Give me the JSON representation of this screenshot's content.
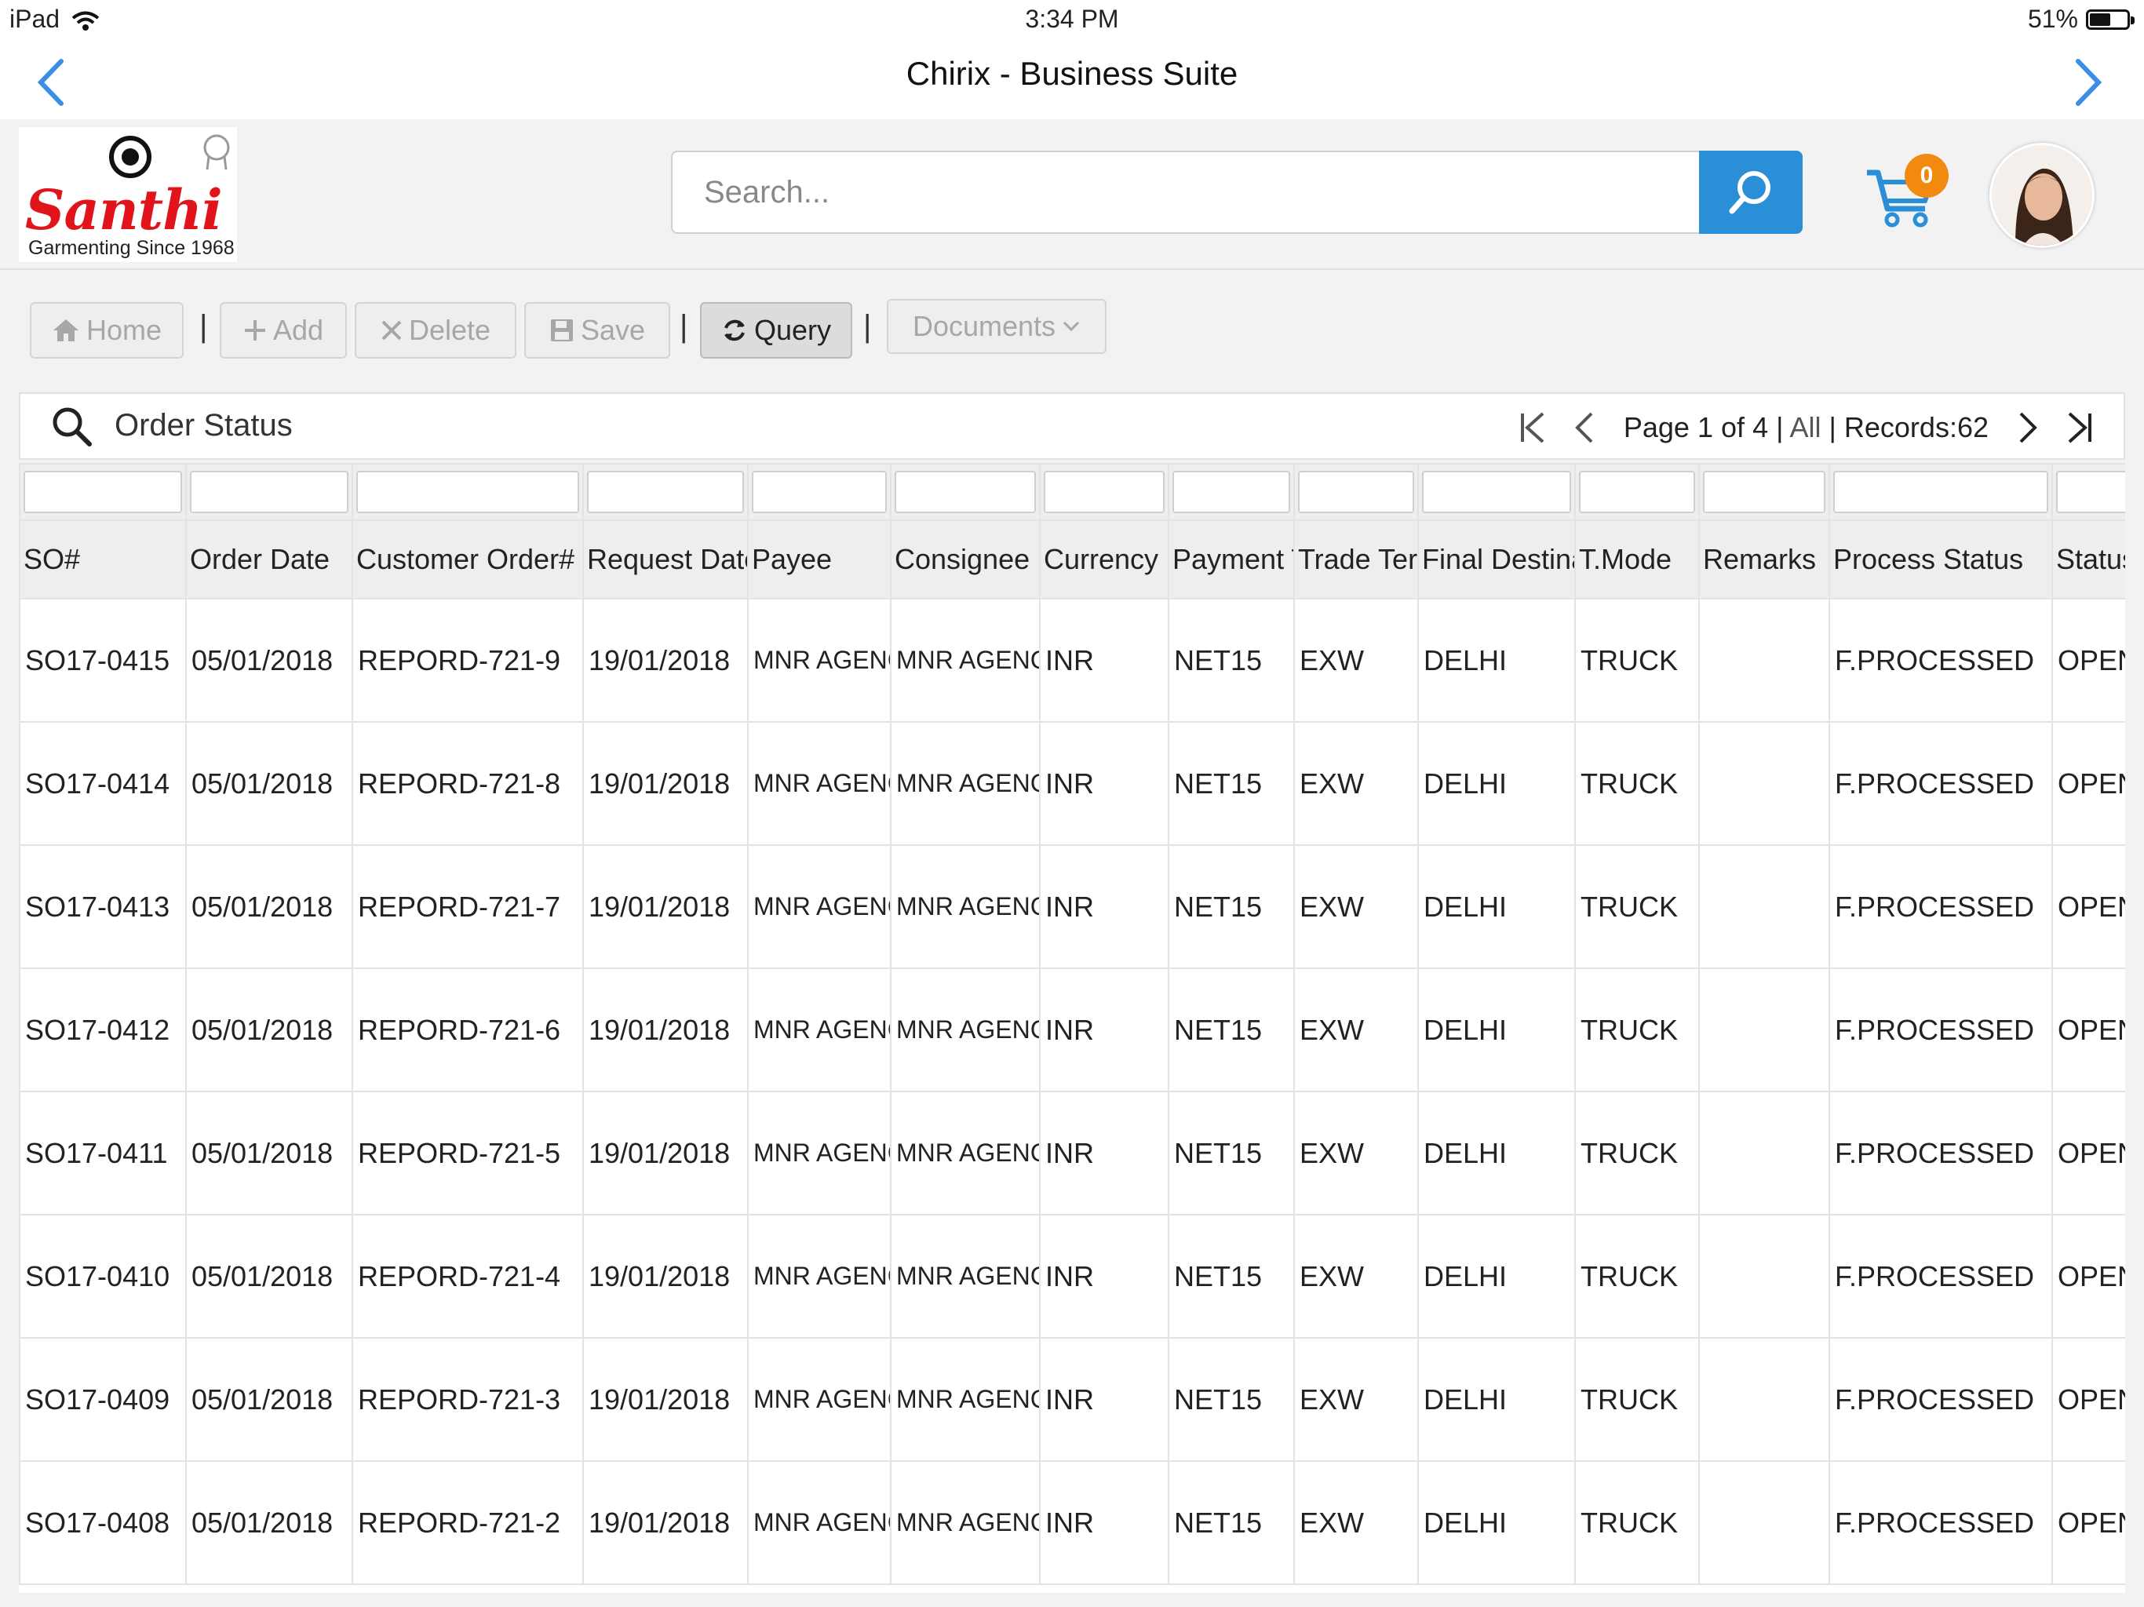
{
  "status_bar": {
    "device": "iPad",
    "time": "3:34 PM",
    "battery": "51%"
  },
  "title_bar": {
    "title": "Chirix - Business Suite"
  },
  "logo": {
    "word": "Santhi",
    "tagline": "Garmenting Since 1968"
  },
  "search": {
    "placeholder": "Search...",
    "value": ""
  },
  "cart": {
    "count": "0"
  },
  "toolbar": {
    "home": "Home",
    "add": "Add",
    "delete": "Delete",
    "save": "Save",
    "query": "Query",
    "documents": "Documents",
    "separator": "|"
  },
  "panel": {
    "title": "Order Status"
  },
  "pager": {
    "page_label": "Page",
    "page": "1",
    "of_label": "of",
    "total_pages": "4",
    "sep1": "|",
    "all": "All",
    "sep2": "|",
    "records": "Records:62"
  },
  "table": {
    "columns": [
      "SO#",
      "Order Date",
      "Customer Order#",
      "Request Date",
      "Payee",
      "Consignee",
      "Currency",
      "Payment Term",
      "Trade Term",
      "Final Destination",
      "T.Mode",
      "Remarks",
      "Process Status",
      "Status"
    ],
    "rows": [
      [
        "SO17-0415",
        "05/01/2018",
        "REPORD-721-9",
        "19/01/2018",
        "MNR AGENCY",
        "MNR AGENCY",
        "INR",
        "NET15",
        "EXW",
        "DELHI",
        "TRUCK",
        "",
        "F.PROCESSED",
        "OPEN"
      ],
      [
        "SO17-0414",
        "05/01/2018",
        "REPORD-721-8",
        "19/01/2018",
        "MNR AGENCY",
        "MNR AGENCY",
        "INR",
        "NET15",
        "EXW",
        "DELHI",
        "TRUCK",
        "",
        "F.PROCESSED",
        "OPEN"
      ],
      [
        "SO17-0413",
        "05/01/2018",
        "REPORD-721-7",
        "19/01/2018",
        "MNR AGENCY",
        "MNR AGENCY",
        "INR",
        "NET15",
        "EXW",
        "DELHI",
        "TRUCK",
        "",
        "F.PROCESSED",
        "OPEN"
      ],
      [
        "SO17-0412",
        "05/01/2018",
        "REPORD-721-6",
        "19/01/2018",
        "MNR AGENCY",
        "MNR AGENCY",
        "INR",
        "NET15",
        "EXW",
        "DELHI",
        "TRUCK",
        "",
        "F.PROCESSED",
        "OPEN"
      ],
      [
        "SO17-0411",
        "05/01/2018",
        "REPORD-721-5",
        "19/01/2018",
        "MNR AGENCY",
        "MNR AGENCY",
        "INR",
        "NET15",
        "EXW",
        "DELHI",
        "TRUCK",
        "",
        "F.PROCESSED",
        "OPEN"
      ],
      [
        "SO17-0410",
        "05/01/2018",
        "REPORD-721-4",
        "19/01/2018",
        "MNR AGENCY",
        "MNR AGENCY",
        "INR",
        "NET15",
        "EXW",
        "DELHI",
        "TRUCK",
        "",
        "F.PROCESSED",
        "OPEN"
      ],
      [
        "SO17-0409",
        "05/01/2018",
        "REPORD-721-3",
        "19/01/2018",
        "MNR AGENCY",
        "MNR AGENCY",
        "INR",
        "NET15",
        "EXW",
        "DELHI",
        "TRUCK",
        "",
        "F.PROCESSED",
        "OPEN"
      ],
      [
        "SO17-0408",
        "05/01/2018",
        "REPORD-721-2",
        "19/01/2018",
        "MNR AGENCY",
        "MNR AGENCY",
        "INR",
        "NET15",
        "EXW",
        "DELHI",
        "TRUCK",
        "",
        "F.PROCESSED",
        "OPEN"
      ]
    ]
  },
  "icons": {
    "wifi": "wifi-icon",
    "battery": "battery-icon",
    "back": "chevron-left-icon",
    "forward": "chevron-right-icon",
    "search": "magnifier-icon",
    "cart": "cart-icon",
    "home": "home-icon",
    "add": "plus-icon",
    "delete": "x-icon",
    "save": "floppy-icon",
    "query": "refresh-icon",
    "documents": "chevron-down-icon",
    "first": "first-page-icon",
    "prev": "prev-page-icon",
    "next": "next-page-icon",
    "last": "last-page-icon"
  },
  "colors": {
    "accent": "#2a8fd6",
    "badge": "#f28a0f",
    "brand_red": "#e2141b",
    "nav_blue": "#3a8ee6"
  }
}
